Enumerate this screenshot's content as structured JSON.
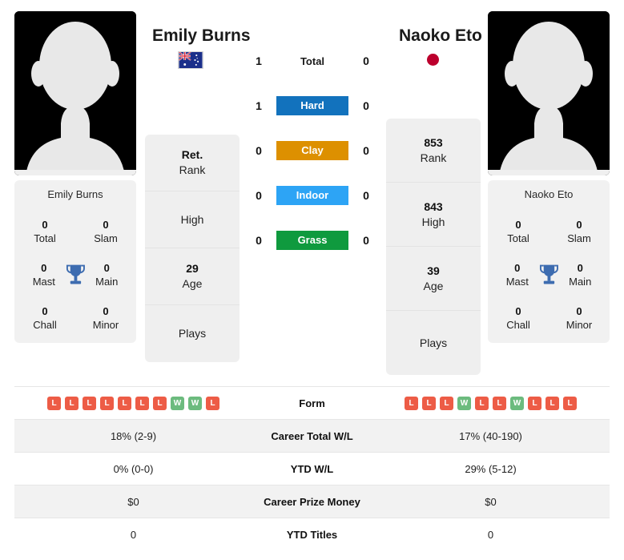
{
  "players": {
    "left": {
      "name": "Emily Burns",
      "flag_icon": "flag-australia",
      "flag_name": "Australia",
      "card_title": "Emily Burns",
      "titles": [
        {
          "value": "0",
          "label": "Total"
        },
        {
          "value": "0",
          "label": "Slam"
        },
        {
          "value": "0",
          "label": "Mast"
        },
        {
          "value": "0",
          "label": "Main"
        },
        {
          "value": "0",
          "label": "Chall"
        },
        {
          "value": "0",
          "label": "Minor"
        }
      ],
      "ranks": [
        {
          "value": "Ret.",
          "label": "Rank"
        },
        {
          "value": "",
          "label": "High"
        },
        {
          "value": "29",
          "label": "Age"
        },
        {
          "value": "",
          "label": "Plays"
        }
      ],
      "form": [
        "L",
        "L",
        "L",
        "L",
        "L",
        "L",
        "L",
        "W",
        "W",
        "L"
      ],
      "career_total_wl": "18% (2-9)",
      "ytd_wl": "0% (0-0)",
      "career_prize_money": "$0",
      "ytd_titles": "0"
    },
    "right": {
      "name": "Naoko Eto",
      "flag_icon": "flag-japan",
      "flag_name": "Japan",
      "card_title": "Naoko Eto",
      "titles": [
        {
          "value": "0",
          "label": "Total"
        },
        {
          "value": "0",
          "label": "Slam"
        },
        {
          "value": "0",
          "label": "Mast"
        },
        {
          "value": "0",
          "label": "Main"
        },
        {
          "value": "0",
          "label": "Chall"
        },
        {
          "value": "0",
          "label": "Minor"
        }
      ],
      "ranks": [
        {
          "value": "853",
          "label": "Rank"
        },
        {
          "value": "843",
          "label": "High"
        },
        {
          "value": "39",
          "label": "Age"
        },
        {
          "value": "",
          "label": "Plays"
        }
      ],
      "form": [
        "L",
        "L",
        "L",
        "W",
        "L",
        "L",
        "W",
        "L",
        "L",
        "L"
      ],
      "career_total_wl": "17% (40-190)",
      "ytd_wl": "29% (5-12)",
      "career_prize_money": "$0",
      "ytd_titles": "0"
    }
  },
  "h2h": [
    {
      "label": "Total",
      "left": "1",
      "right": "0",
      "badge": false,
      "color": ""
    },
    {
      "label": "Hard",
      "left": "1",
      "right": "0",
      "badge": true,
      "color": "#1272bd"
    },
    {
      "label": "Clay",
      "left": "0",
      "right": "0",
      "badge": true,
      "color": "#dd9000"
    },
    {
      "label": "Indoor",
      "left": "0",
      "right": "0",
      "badge": true,
      "color": "#2da4f5"
    },
    {
      "label": "Grass",
      "left": "0",
      "right": "0",
      "badge": true,
      "color": "#0f9a3e"
    }
  ],
  "table": {
    "rows": [
      {
        "label": "Form",
        "type": "form"
      },
      {
        "label": "Career Total W/L",
        "type": "text",
        "key": "career_total_wl"
      },
      {
        "label": "YTD W/L",
        "type": "text",
        "key": "ytd_wl"
      },
      {
        "label": "Career Prize Money",
        "type": "text",
        "key": "career_prize_money"
      },
      {
        "label": "YTD Titles",
        "type": "text",
        "key": "ytd_titles"
      }
    ]
  },
  "colors": {
    "win": "#6cbb7e",
    "loss": "#ed5c46",
    "card_bg": "#f1f1f1",
    "row_shade": "#f2f2f2"
  }
}
